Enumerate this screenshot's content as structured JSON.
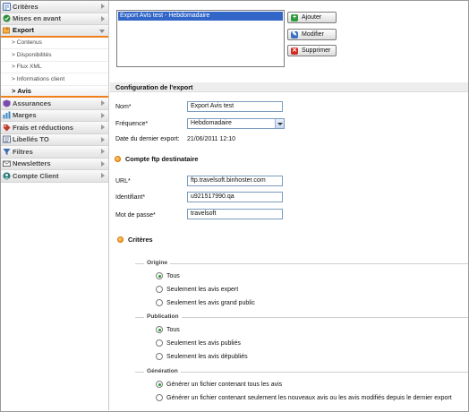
{
  "sidebar": {
    "items": [
      {
        "label": "Critères",
        "color": "#3b6bb0",
        "state": "closed"
      },
      {
        "label": "Mises en avant",
        "color": "#2e8b3a",
        "state": "closed"
      },
      {
        "label": "Export",
        "color": "#d4770f",
        "state": "open"
      },
      {
        "label": "Assurances",
        "color": "#7a4ab0",
        "state": "closed"
      },
      {
        "label": "Marges",
        "color": "#3a8bc8",
        "state": "closed"
      },
      {
        "label": "Frais et réductions",
        "color": "#c0392b",
        "state": "closed"
      },
      {
        "label": "Libellés TO",
        "color": "#5a6b8c",
        "state": "closed"
      },
      {
        "label": "Filtres",
        "color": "#3b6bb0",
        "state": "closed"
      },
      {
        "label": "Newsletters",
        "color": "#6a6a6a",
        "state": "closed"
      },
      {
        "label": "Compte Client",
        "color": "#2a7a7a",
        "state": "closed"
      }
    ],
    "export_sub": [
      "> Contenus",
      "> Disponibilités",
      "> Flux XML",
      "> Informations client",
      "> Avis"
    ]
  },
  "export_list": {
    "selected": "Export Avis test - Hebdomadaire"
  },
  "buttons": {
    "add": "Ajouter",
    "edit": "Modifier",
    "delete": "Supprimer"
  },
  "config": {
    "title": "Configuration de l'export",
    "name_label": "Nom*",
    "name_value": "Export Avis test",
    "frequency_label": "Fréquence*",
    "frequency_value": "Hebdomadaire",
    "last_export_label": "Date du dernier export:",
    "last_export_value": "21/06/2011 12:10"
  },
  "ftp": {
    "title": "Compte ftp destinataire",
    "url_label": "URL*",
    "url_value": "ftp.travelsoft.binhoster.com",
    "id_label": "Identifiant*",
    "id_value": "u921517990.qa",
    "pwd_label": "Mot de passe*",
    "pwd_value": "travelsoft"
  },
  "criteria": {
    "title": "Critères",
    "origin": {
      "legend": "Origine",
      "options": [
        "Tous",
        "Seulement les avis expert",
        "Seulement les avis grand public"
      ],
      "selected": 0
    },
    "publication": {
      "legend": "Publication",
      "options": [
        "Tous",
        "Seulement les avis publiés",
        "Seulement les avis dépubliés"
      ],
      "selected": 0
    },
    "generation": {
      "legend": "Génération",
      "options": [
        "Générer un fichier contenant tous les avis",
        "Générer un fichier contenant seulement les nouveaux avis ou les avis modifiés depuis le dernier export"
      ],
      "selected": 0
    }
  }
}
